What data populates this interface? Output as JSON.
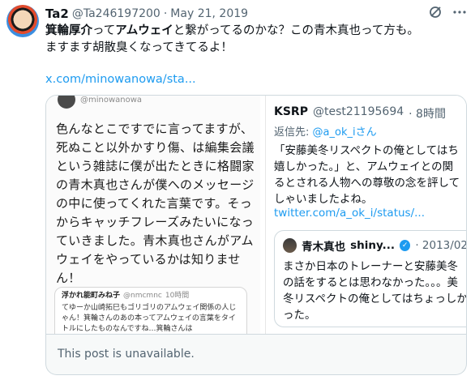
{
  "tweet": {
    "display_name": "Ta2",
    "handle": "@Ta246197200",
    "separator": "·",
    "date": "May 21, 2019",
    "text_line1_bold": "箕輪厚介",
    "text_line1_a": "って",
    "text_line1_bold2": "アムウェイ",
    "text_line1_b": "と繋がってるのかな？この青木真也って方も。",
    "text_line2": "ますます胡散臭くなってきてるよ！",
    "link": "x.com/minowanowa/sta..."
  },
  "media": {
    "left": {
      "top_handle": "@minowanowa",
      "body": "色んなとこですでに言ってますが、死ぬこと以外かすり傷、は編集会議という雑誌に僕が出たときに格闘家の青木真也さんが僕へのメッセージの中に使ってくれた言葉です。そっからキャッチフレーズみたいになっていきました。青木真也さんがアムウェイをやっているかは知りません！",
      "embedded": {
        "name": "浮かれ能町みね子",
        "handle": "@nmcmnc",
        "time": "10時間",
        "body": "てゆーか山崎拓巳もゴリゴリのアムウェイ関係の人じゃん！箕輪さんのあの本ってアムウェイの言葉をタイトルにしたものなんですね…箕輪さんは"
      }
    },
    "right": {
      "name": "KSRP",
      "handle": "@test21195694",
      "time": "· 8時間",
      "reply_to_label": "返信先:",
      "reply_to_handle": "@a_ok_iさん",
      "body": "「安藤美冬リスペクトの俺としてはち\n嬉しかった。」と、アムウェイとの関\nるとされる人物への尊敬の念を評して\nしゃいましたよね。",
      "link": "twitter.com/a_ok_i/status/...",
      "quote": {
        "name": "青木真也",
        "handle": "shiny...",
        "date": "· 2013/02",
        "body": "まさか日本のトレーナーと安藤美冬の話をするとは思わなかった。。。美冬リスペクトの俺としてはちょっしかった。"
      }
    }
  },
  "unavailable_text": "This post is unavailable.",
  "icons": [
    "grok-icon",
    "more-icon",
    "verified-icon"
  ],
  "colors": {
    "link": "#1d9bf0",
    "muted": "#536471",
    "border": "#cfd9de"
  }
}
